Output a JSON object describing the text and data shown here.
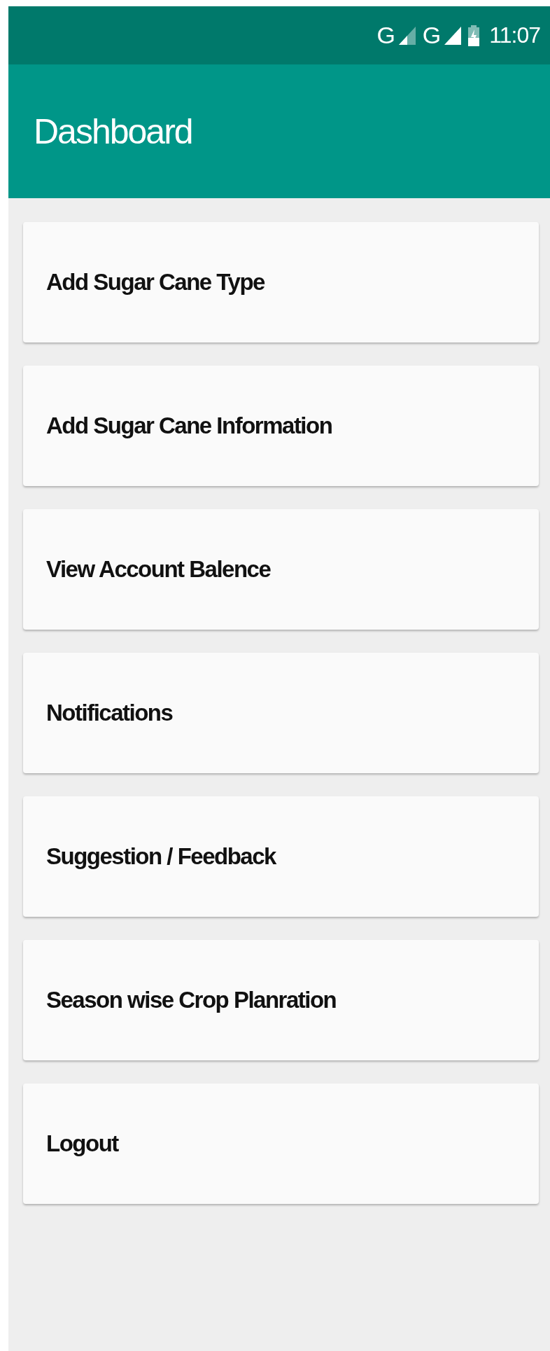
{
  "status_bar": {
    "network_1": "G",
    "network_2": "G",
    "time": "11:07"
  },
  "app_bar": {
    "title": "Dashboard"
  },
  "menu_items": [
    {
      "label": "Add Sugar Cane Type"
    },
    {
      "label": "Add Sugar Cane Information"
    },
    {
      "label": "View Account Balence"
    },
    {
      "label": "Notifications"
    },
    {
      "label": "Suggestion / Feedback"
    },
    {
      "label": "Season wise Crop Planration"
    },
    {
      "label": "Logout"
    }
  ]
}
